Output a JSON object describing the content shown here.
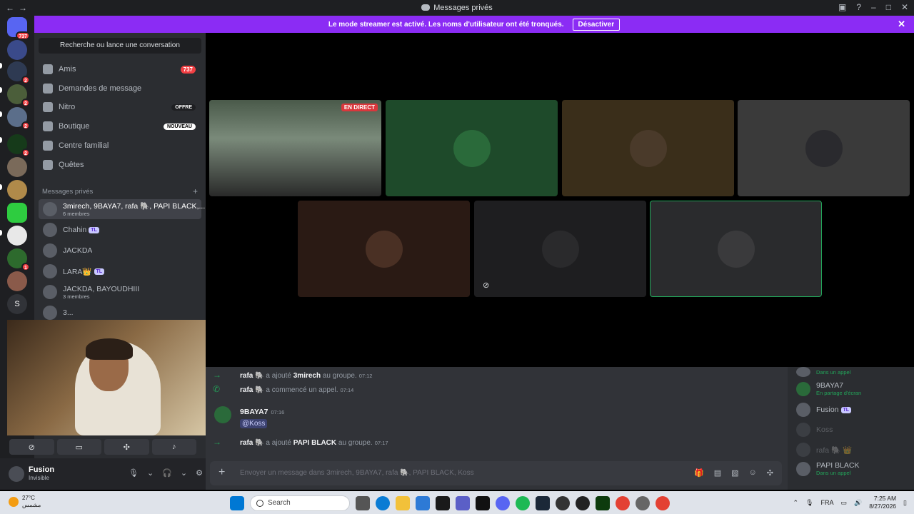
{
  "titlebar": {
    "title": "Messages privés"
  },
  "banner": {
    "text": "Le mode streamer est activé. Les noms d'utilisateur ont été tronqués.",
    "button": "Désactiver"
  },
  "servers": {
    "home_badge": "737",
    "badges": [
      "2",
      "2",
      "2",
      "2",
      "1"
    ],
    "letter": "S"
  },
  "sidebar": {
    "search": "Recherche ou lance une conversation",
    "nav": [
      {
        "label": "Amis",
        "tag": "737"
      },
      {
        "label": "Demandes de message"
      },
      {
        "label": "Nitro",
        "tag": "OFFRE"
      },
      {
        "label": "Boutique",
        "tag": "NOUVEAU"
      },
      {
        "label": "Centre familial"
      },
      {
        "label": "Quêtes"
      }
    ],
    "dm_header": "Messages privés",
    "dms": [
      {
        "name": "3mirech, 9BAYA7, rafa 🐘, PAPI BLACK,...",
        "sub": "6 membres"
      },
      {
        "name": "Chahin",
        "badge": "TL"
      },
      {
        "name": "JACKDA"
      },
      {
        "name": "LARA👑",
        "badge": "TL"
      },
      {
        "name": "JACKDA, BAYOUDHIII",
        "sub": "3 membres"
      },
      {
        "name": "3..."
      }
    ]
  },
  "user": {
    "name": "Fusion",
    "status": "Invisible"
  },
  "stage": {
    "live_label": "EN DIRECT"
  },
  "chat": {
    "events": [
      {
        "user": "rafa 🐘",
        "text": "a ajouté",
        "target": "3mirech",
        "suffix": "au groupe.",
        "time": "07:12"
      },
      {
        "user": "rafa 🐘",
        "text": "a commencé un appel.",
        "time": "07:14"
      }
    ],
    "message": {
      "author": "9BAYA7",
      "time": "07:16",
      "mention": "@Koss"
    },
    "event3": {
      "user": "rafa 🐘",
      "text": "a ajouté",
      "target": "PAPI BLACK",
      "suffix": "au groupe.",
      "time": "07:17"
    },
    "placeholder": "Envoyer un message dans 3mirech, 9BAYA7, rafa 🐘, PAPI BLACK, Koss"
  },
  "members": [
    {
      "name": "",
      "status": "Dans un appel"
    },
    {
      "name": "9BAYA7",
      "status": "En partage d'écran"
    },
    {
      "name": "Fusion",
      "badge": "TL"
    },
    {
      "name": "Koss"
    },
    {
      "name": "rafa 🐘 👑"
    },
    {
      "name": "PAPI BLACK",
      "status": "Dans un appel"
    }
  ],
  "taskbar": {
    "weather_temp": "27°C",
    "weather_text": "مشمس",
    "search": "Search",
    "lang": "FRA",
    "time": "7:25 AM",
    "date": "8/27/2026"
  },
  "colors": {
    "accent": "#8b2cf4",
    "online": "#23a55a",
    "danger": "#da373c"
  }
}
